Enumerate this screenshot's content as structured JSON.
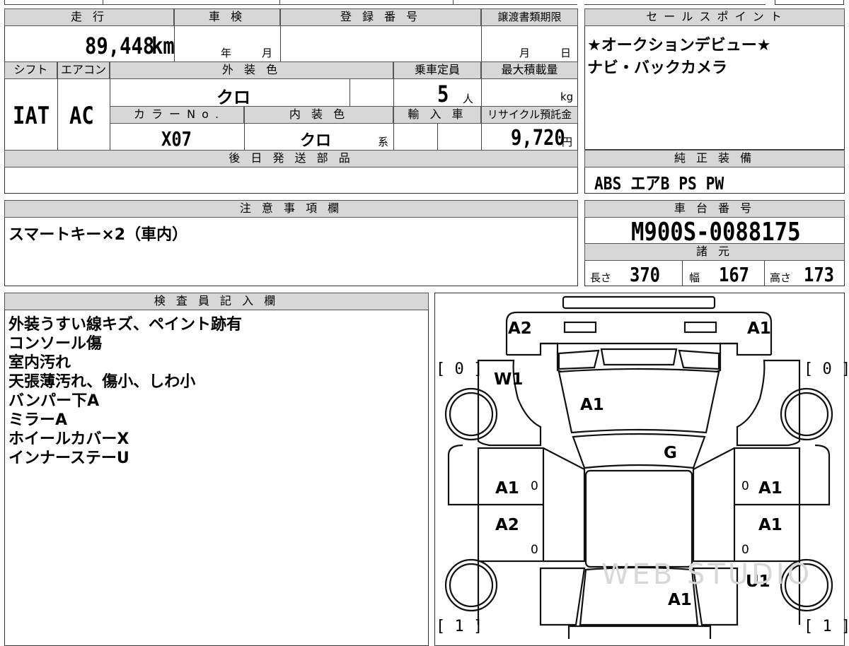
{
  "top_left": {
    "h_mileage": "走 行",
    "mileage": "89,448",
    "mileage_unit": "km",
    "h_inspection": "車 検",
    "inspection_year": "年",
    "inspection_month": "月",
    "h_registration": "登 録 番 号",
    "h_transfer": "譲渡書類期限",
    "transfer_month": "月",
    "transfer_day": "日",
    "h_shift": "シフト",
    "h_ac": "エアコン",
    "h_exterior_color": "外 装 色",
    "h_capacity": "乗車定員",
    "h_max_load": "最大積載量",
    "shift": "IAT",
    "ac": "AC",
    "exterior_color": "クロ",
    "capacity": "5",
    "capacity_unit": "人",
    "max_load_unit": "kg",
    "h_color_no": "カ ラ ー N o .",
    "h_interior_color": "内 装 色",
    "h_import": "輸 入 車",
    "h_recycle": "リサイクル預託金",
    "color_no": "X07",
    "interior_color": "クロ",
    "interior_suffix": "系",
    "recycle_fee": "9,720",
    "recycle_unit": "円",
    "h_later_parts": "後 日 発 送 部 品"
  },
  "sales_point": {
    "header": "セ ー ル ス ポ イ ン ト",
    "line1": "★オークションデビュー★",
    "line2": "ナビ・バックカメラ"
  },
  "equipment": {
    "header": "純 正 装 備",
    "value": "ABS エアB PS PW"
  },
  "notes": {
    "header": "注 意 事 項 欄",
    "value": "スマートキー×2（車内）"
  },
  "chassis": {
    "header": "車 台 番 号",
    "value": "M900S-0088175",
    "spec_header": "諸 元",
    "length_label": "長さ",
    "length": "370",
    "width_label": "幅",
    "width": "167",
    "height_label": "高さ",
    "height": "173"
  },
  "inspector": {
    "header": "検 査 員 記 入 欄",
    "lines": [
      "外装うすい線キズ、ペイント跡有",
      "コンソール傷",
      "室内汚れ",
      "天張薄汚れ、傷小、しわ小",
      "バンパー下A",
      "ミラーA",
      "ホイールカバーX",
      "インナーステーU"
    ]
  },
  "diagram": {
    "front_left": "A2",
    "front_right": "A1",
    "tire_fl": "[ 0 ]",
    "tire_fr": "[ 0 ]",
    "tire_rl": "[ 1 ]",
    "tire_rr": "[ 1 ]",
    "fender_left": "W1",
    "hood": "A1",
    "windshield": "G",
    "door_fl": "A1",
    "door_fr": "A1",
    "door_rl": "A2",
    "door_rr": "A1",
    "handle_a": "0",
    "handle_b": "0",
    "handle_c": "0",
    "handle_d": "0",
    "rear_right": "U1",
    "rear": "A1",
    "watermark": "WEB STUDIO"
  }
}
